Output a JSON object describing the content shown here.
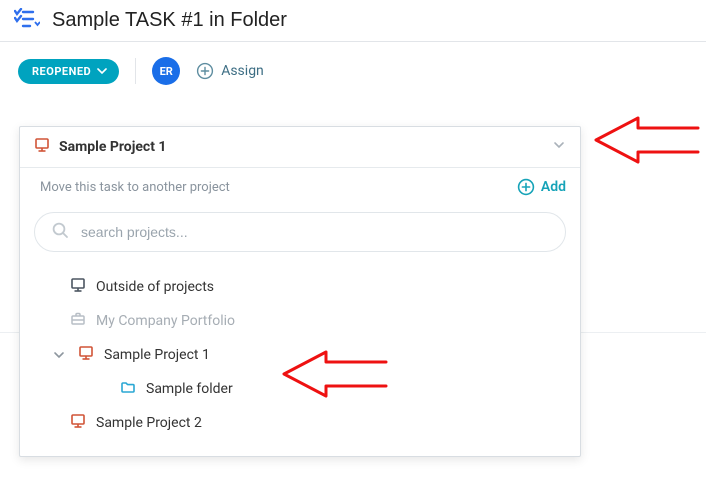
{
  "title": "Sample TASK #1 in Folder",
  "status": {
    "label": "REOPENED"
  },
  "avatar": {
    "initials": "ER"
  },
  "assign": {
    "label": "Assign"
  },
  "panel": {
    "project_name": "Sample Project 1",
    "hint": "Move this task to another project",
    "add_label": "Add",
    "search_placeholder": "search projects..."
  },
  "tree": {
    "outside": "Outside of projects",
    "portfolio": "My Company Portfolio",
    "project1": "Sample Project 1",
    "project1_folder": "Sample folder",
    "project2": "Sample Project 2"
  },
  "colors": {
    "status_pill": "#00a3bf",
    "avatar_bg": "#1a6ee8",
    "accent_teal": "#16a3b8",
    "project_icon": "#d15437",
    "folder_icon": "#2aa7d4",
    "annotation": "#e11"
  }
}
